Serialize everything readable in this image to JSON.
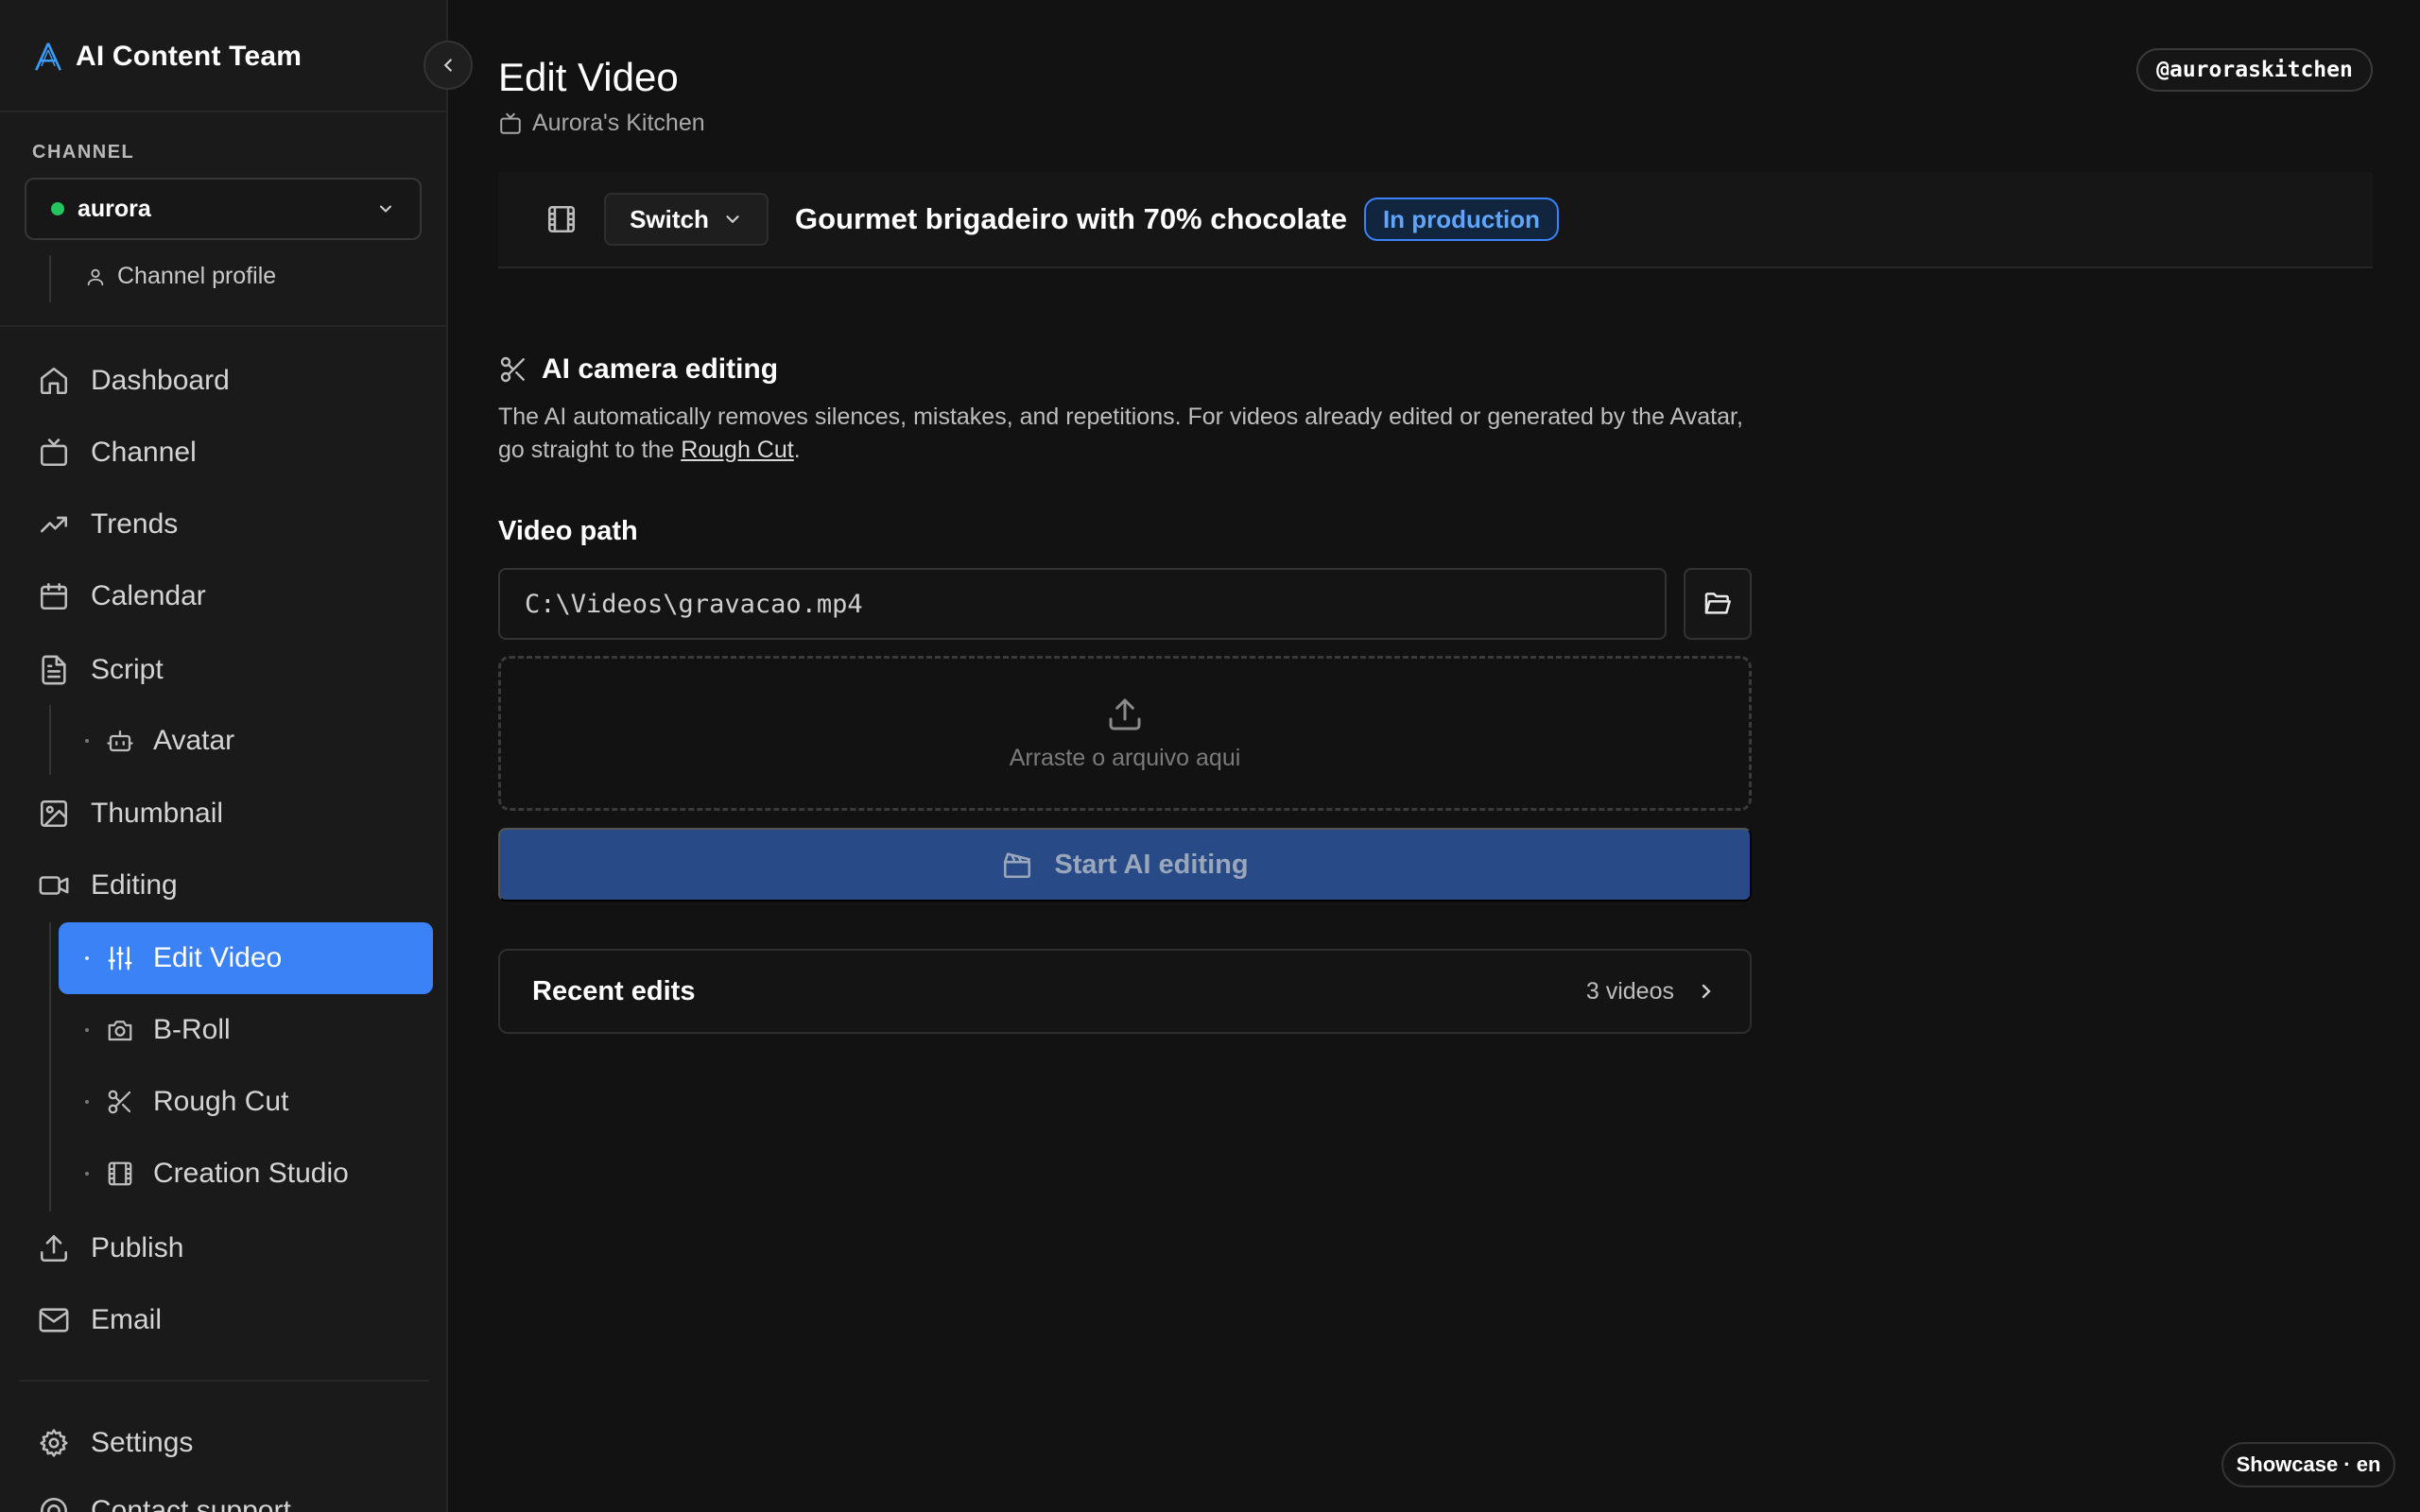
{
  "brand": {
    "name": "AI Content Team"
  },
  "channel": {
    "section_label": "CHANNEL",
    "selected": "aurora",
    "status_color": "#22c55e",
    "profile_label": "Channel profile"
  },
  "nav": {
    "dashboard": "Dashboard",
    "channel": "Channel",
    "trends": "Trends",
    "calendar": "Calendar",
    "script": "Script",
    "avatar": "Avatar",
    "thumbnail": "Thumbnail",
    "editing": "Editing",
    "edit_video": "Edit Video",
    "broll": "B-Roll",
    "rough_cut": "Rough Cut",
    "creation_studio": "Creation Studio",
    "publish": "Publish",
    "email": "Email",
    "settings": "Settings",
    "contact_support": "Contact support"
  },
  "header": {
    "title": "Edit Video",
    "subtitle": "Aurora's Kitchen",
    "handle": "@auroraskitchen"
  },
  "video_bar": {
    "switch_label": "Switch",
    "video_title": "Gourmet brigadeiro with 70% chocolate",
    "status": "In production"
  },
  "ai_editing": {
    "title": "AI camera editing",
    "description_pre": "The AI automatically removes silences, mistakes, and repetitions. For videos already edited or generated by the Avatar, go straight to the ",
    "description_link": "Rough Cut",
    "description_post": ".",
    "path_label": "Video path",
    "path_value": "C:\\Videos\\gravacao.mp4",
    "dropzone_text": "Arraste o arquivo aqui",
    "start_label": "Start AI editing"
  },
  "recent": {
    "title": "Recent edits",
    "count": "3 videos"
  },
  "footer": {
    "showcase": "Showcase · en"
  },
  "colors": {
    "accent": "#3b82f6",
    "start_button": "#284a87",
    "brand_icon": "#3b9eff"
  }
}
